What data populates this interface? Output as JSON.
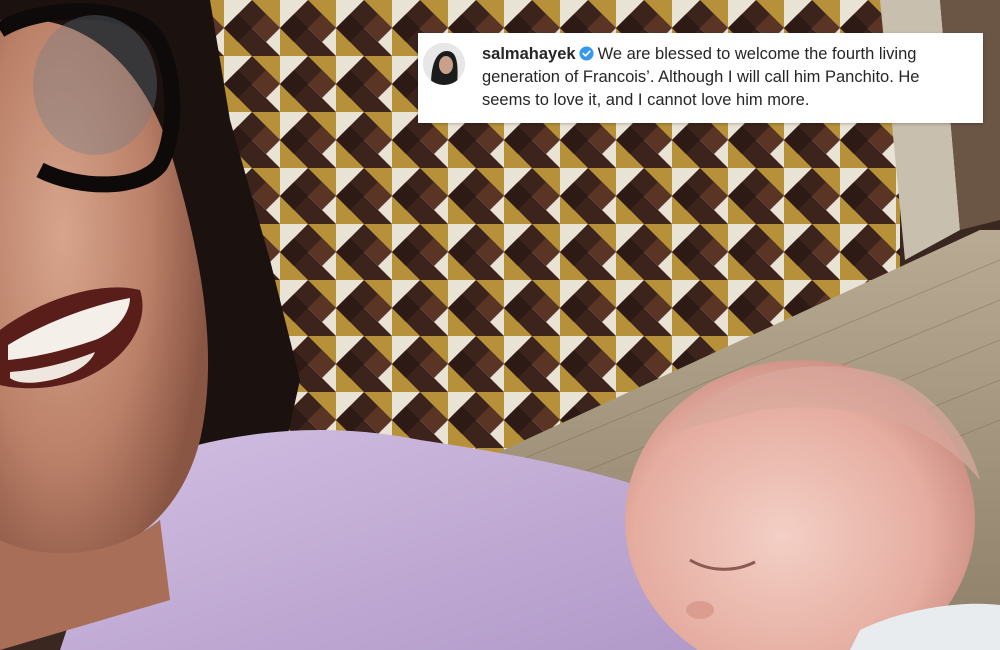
{
  "post": {
    "username": "salmahayek",
    "verified": true,
    "caption": "We are blessed to welcome the fourth living generation of Francois’. Although I will call him Panchito. He seems to love it, and I cannot love him more."
  },
  "colors": {
    "card_background": "#ffffff",
    "text": "#262626",
    "verified_badge": "#3897f0",
    "shirt": "#c7b1da",
    "wall_dark": "#3c241d",
    "wall_gold": "#b6913a",
    "wall_light": "#e9e3d5"
  }
}
